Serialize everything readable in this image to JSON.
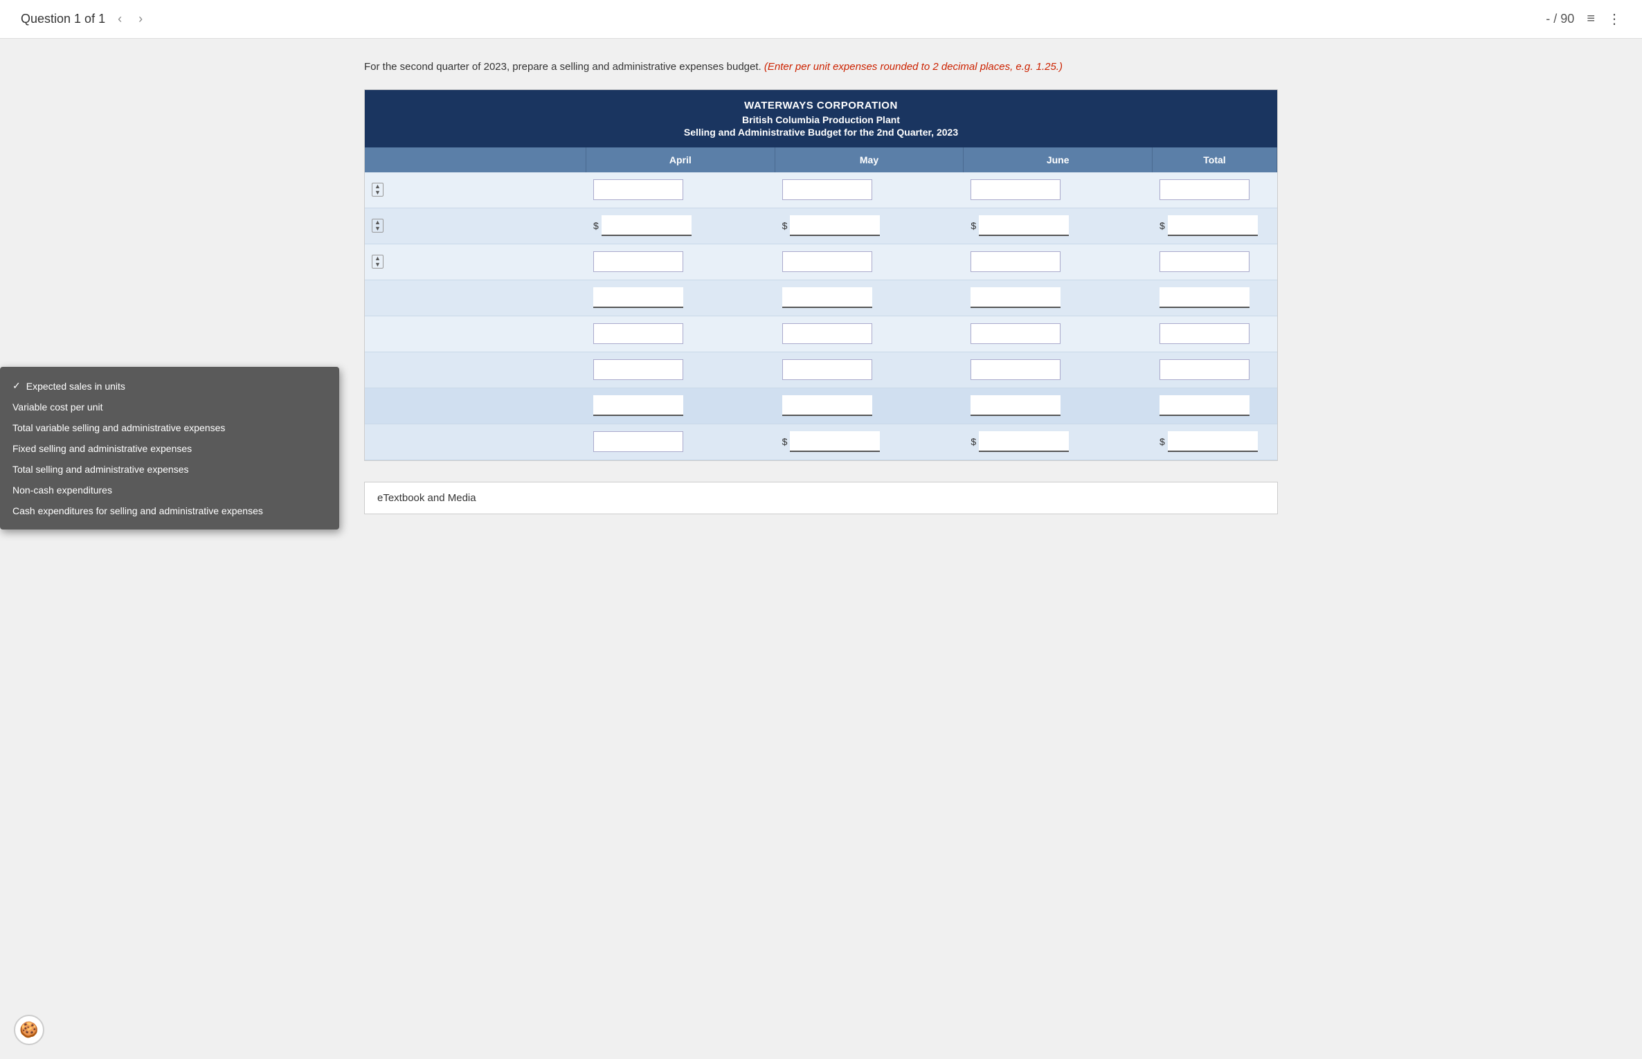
{
  "topbar": {
    "question_label": "Question 1 of 1",
    "prev_arrow": "‹",
    "next_arrow": "›",
    "score": "- / 90",
    "list_icon": "≡",
    "more_icon": "⋮"
  },
  "question": {
    "text_before": "For the second quarter of 2023, prepare a selling and administrative expenses budget.",
    "text_red": "(Enter per unit expenses rounded to 2 decimal places, e.g. 1.25.)"
  },
  "table": {
    "corp_name": "WATERWAYS CORPORATION",
    "plant_name": "British Columbia Production Plant",
    "budget_title": "Selling and Administrative Budget for the 2nd Quarter, 2023",
    "columns": [
      "",
      "April",
      "May",
      "June",
      "Total"
    ],
    "rows": [
      {
        "label": "",
        "has_spinner": true,
        "has_dollar": false,
        "underline": false
      },
      {
        "label": "",
        "has_spinner": true,
        "has_dollar": true,
        "underline": true
      },
      {
        "label": "",
        "has_spinner": true,
        "has_dollar": false,
        "underline": false
      },
      {
        "label": "",
        "has_spinner": false,
        "has_dollar": false,
        "underline": true
      },
      {
        "label": "",
        "has_spinner": false,
        "has_dollar": false,
        "underline": false
      },
      {
        "label": "",
        "has_spinner": false,
        "has_dollar": false,
        "underline": false
      },
      {
        "label": "",
        "has_spinner": false,
        "has_dollar": false,
        "underline": true
      },
      {
        "label": "",
        "has_spinner": false,
        "has_dollar": true,
        "underline": true
      }
    ]
  },
  "dropdown": {
    "items": [
      {
        "text": "Expected sales in units",
        "selected": false
      },
      {
        "text": "Variable cost per unit",
        "selected": false
      },
      {
        "text": "Total variable selling and administrative expenses",
        "selected": false
      },
      {
        "text": "Fixed selling and administrative expenses",
        "selected": false
      },
      {
        "text": "Total selling and administrative expenses",
        "selected": false
      },
      {
        "text": "Non-cash expenditures",
        "selected": false
      },
      {
        "text": "Cash expenditures for selling and administrative expenses",
        "selected": false
      }
    ]
  },
  "etextbook": {
    "label": "eTextbook and Media"
  },
  "cookie": {
    "icon": "🍪"
  }
}
